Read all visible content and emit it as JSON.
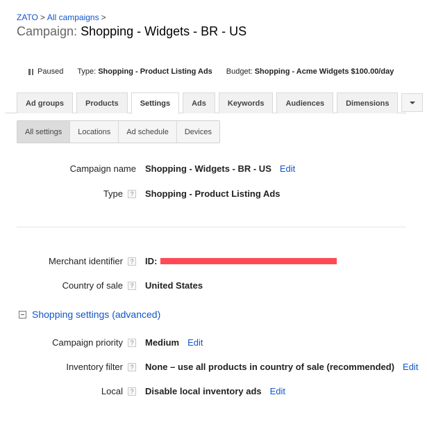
{
  "breadcrumb": {
    "items": [
      "ZATO",
      "All campaigns"
    ],
    "separator": ">"
  },
  "title": {
    "prefix": "Campaign:",
    "name": "Shopping - Widgets - BR - US"
  },
  "status_bar": {
    "status": "Paused",
    "type_label": "Type:",
    "type_value": "Shopping - Product Listing Ads",
    "budget_label": "Budget:",
    "budget_value": "Shopping - Acme Widgets $100.00/day"
  },
  "tabs": [
    {
      "label": "Ad groups",
      "active": false
    },
    {
      "label": "Products",
      "active": false
    },
    {
      "label": "Settings",
      "active": true
    },
    {
      "label": "Ads",
      "active": false
    },
    {
      "label": "Keywords",
      "active": false
    },
    {
      "label": "Audiences",
      "active": false
    },
    {
      "label": "Dimensions",
      "active": false
    }
  ],
  "subtabs": [
    {
      "label": "All settings",
      "active": true
    },
    {
      "label": "Locations",
      "active": false
    },
    {
      "label": "Ad schedule",
      "active": false
    },
    {
      "label": "Devices",
      "active": false
    }
  ],
  "settings": {
    "campaign_name": {
      "label": "Campaign name",
      "value": "Shopping - Widgets - BR - US",
      "edit": "Edit"
    },
    "type": {
      "label": "Type",
      "help": "?",
      "value": "Shopping - Product Listing Ads"
    },
    "merchant_identifier": {
      "label": "Merchant identifier",
      "help": "?",
      "value": "ID:"
    },
    "country_of_sale": {
      "label": "Country of sale",
      "help": "?",
      "value": "United States"
    }
  },
  "advanced": {
    "section_label": "Shopping settings (advanced)",
    "campaign_priority": {
      "label": "Campaign priority",
      "help": "?",
      "value": "Medium",
      "edit": "Edit"
    },
    "inventory_filter": {
      "label": "Inventory filter",
      "help": "?",
      "value": "None – use all products in country of sale (recommended)",
      "edit": "Edit"
    },
    "local": {
      "label": "Local",
      "help": "?",
      "value": "Disable local inventory ads",
      "edit": "Edit"
    }
  }
}
